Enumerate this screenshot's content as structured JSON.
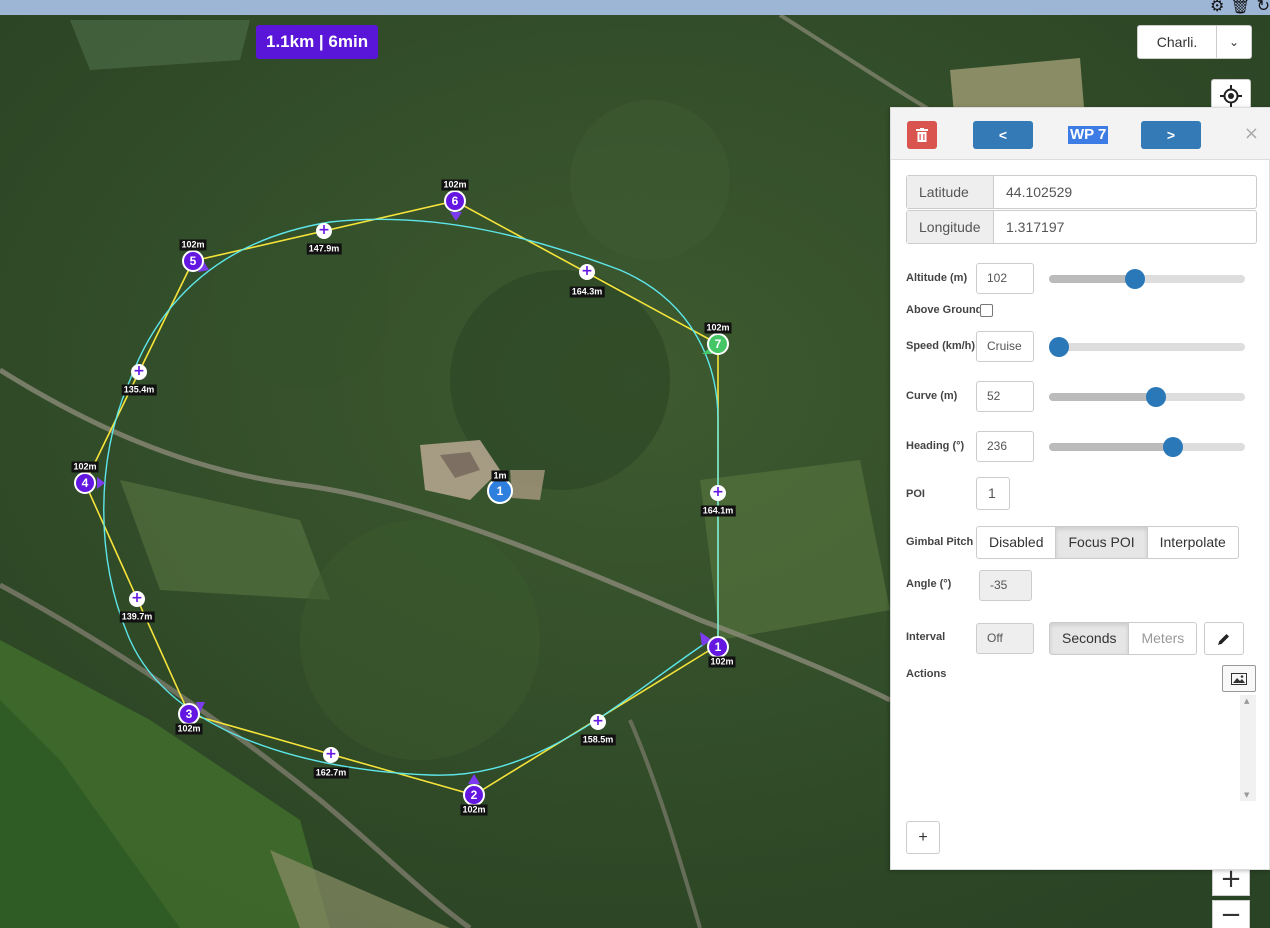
{
  "topbar": {
    "icons": [
      "gear-icon",
      "trash-icon",
      "refresh-icon"
    ],
    "glyphs": [
      "⚙",
      "🗑",
      "↻"
    ]
  },
  "map": {
    "stats": "1.1km | 6min",
    "user_select": {
      "value": "Charli.",
      "caret": "⌄"
    },
    "zoom_in": "+",
    "zoom_out": "−",
    "home": {
      "label": "1",
      "altitude": "1m"
    },
    "waypoints": [
      {
        "n": "1",
        "alt": "102m"
      },
      {
        "n": "2",
        "alt": "102m"
      },
      {
        "n": "3",
        "alt": "102m"
      },
      {
        "n": "4",
        "alt": "102m"
      },
      {
        "n": "5",
        "alt": "102m"
      },
      {
        "n": "6",
        "alt": "102m"
      },
      {
        "n": "7",
        "alt": "102m"
      }
    ],
    "segments": [
      "158.5m",
      "162.7m",
      "139.7m",
      "135.4m",
      "147.9m",
      "164.3m",
      "164.1m"
    ],
    "colors": {
      "path": "#f5e33b",
      "curve": "#5ee6ea",
      "waypoint": "#6417e0",
      "active_waypoint": "#44c566",
      "home": "#2f7fdf",
      "stats_badge": "#5a16d8"
    }
  },
  "panel": {
    "title": "WP 7",
    "prev": "<",
    "next": ">",
    "close": "×",
    "latitude": {
      "label": "Latitude",
      "value": "44.102529"
    },
    "longitude": {
      "label": "Longitude",
      "value": "1.317197"
    },
    "altitude": {
      "label": "Altitude (m)",
      "value": "102",
      "level": 0.43
    },
    "above_ground": {
      "label": "Above Ground",
      "checked": false
    },
    "speed": {
      "label": "Speed (km/h)",
      "value": "Cruise",
      "level": 0.0
    },
    "curve": {
      "label": "Curve (m)",
      "value": "52",
      "level": 0.55
    },
    "heading": {
      "label": "Heading (°)",
      "value": "236",
      "level": 0.65
    },
    "poi": {
      "label": "POI",
      "value": "1"
    },
    "gimbal_pitch": {
      "label": "Gimbal Pitch",
      "options": [
        "Disabled",
        "Focus POI",
        "Interpolate"
      ],
      "selected": "Focus POI"
    },
    "angle": {
      "label": "Angle (°)",
      "value": "-35"
    },
    "interval": {
      "label": "Interval",
      "value": "Off",
      "options": [
        "Seconds",
        "Meters"
      ],
      "selected": "Seconds"
    },
    "actions": {
      "label": "Actions",
      "add": "+"
    }
  }
}
